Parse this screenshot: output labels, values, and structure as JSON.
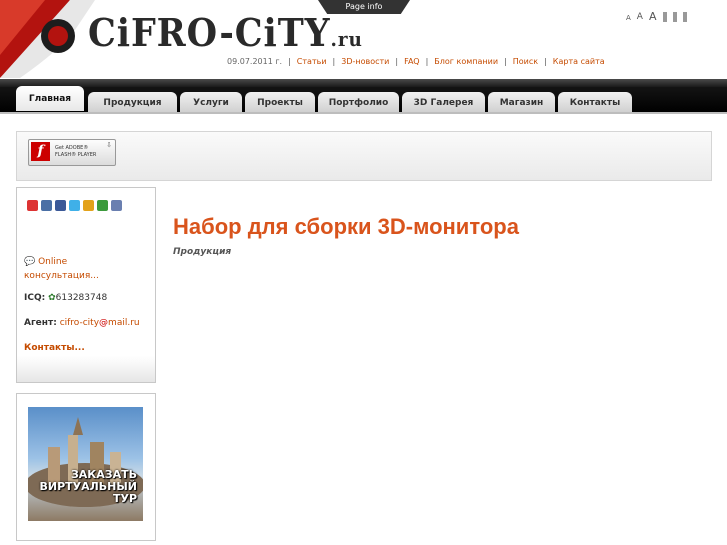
{
  "header": {
    "logo_main": "CiFRO-CiTY",
    "logo_suffix": ".ru",
    "page_info": "Page info",
    "font_size_labels": [
      "A",
      "A",
      "A"
    ]
  },
  "top_links": {
    "date": "09.07.2011 г.",
    "items": [
      "Статьи",
      "3D-новости",
      "FAQ",
      "Блог компании",
      "Поиск",
      "Карта сайта"
    ]
  },
  "nav": {
    "tabs": [
      "Главная",
      "Продукция",
      "Услуги",
      "Проекты",
      "Портфолио",
      "3D Галерея",
      "Магазин",
      "Контакты"
    ],
    "active": "Главная"
  },
  "flash_badge": {
    "line1": "Get ADOBE®",
    "line2": "FLASH® PLAYER"
  },
  "sidebar": {
    "online_label": "Online консультация...",
    "icq_label": "ICQ:",
    "icq_number": "613283748",
    "agent_label": "Агент:",
    "agent_user": "cifro-city",
    "agent_domain": "mail.ru",
    "contacts_link": "Контакты...",
    "tour_text": "ЗАКАЗАТЬ ВИРТУАЛЬНЫЙ ТУР"
  },
  "content": {
    "title": "Набор для сборки 3D-монитора",
    "category": "Продукция"
  },
  "colors": {
    "accent": "#d9541c",
    "link": "#c54b00",
    "nav_bg": "#111111"
  }
}
